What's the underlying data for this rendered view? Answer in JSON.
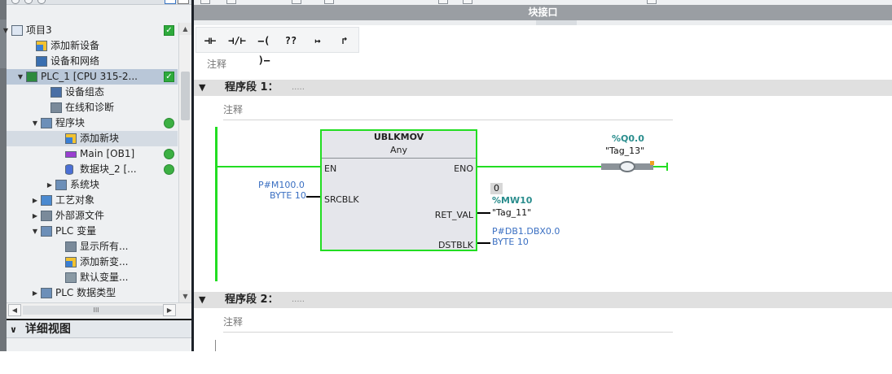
{
  "tree": {
    "rows": [
      {
        "label": "项目3",
        "icon": "project-icon",
        "arrow": "▼",
        "status": "check"
      },
      {
        "label": "添加新设备",
        "icon": "add-device-icon",
        "arrow": "",
        "status": ""
      },
      {
        "label": "设备和网络",
        "icon": "network-icon",
        "arrow": "",
        "status": ""
      },
      {
        "label": "PLC_1 [CPU 315-2...",
        "icon": "plc-icon",
        "arrow": "▼",
        "status": "check"
      },
      {
        "label": "设备组态",
        "icon": "device-config-icon",
        "arrow": "",
        "status": ""
      },
      {
        "label": "在线和诊断",
        "icon": "online-diag-icon",
        "arrow": "",
        "status": ""
      },
      {
        "label": "程序块",
        "icon": "folder-icon",
        "arrow": "▼",
        "status": "dot"
      },
      {
        "label": "添加新块",
        "icon": "add-block-icon",
        "arrow": "",
        "status": ""
      },
      {
        "label": "Main [OB1]",
        "icon": "ob-icon",
        "arrow": "",
        "status": "dot"
      },
      {
        "label": "数据块_2 [...",
        "icon": "db-icon",
        "arrow": "",
        "status": "dot"
      },
      {
        "label": "系统块",
        "icon": "folder-icon",
        "arrow": "▶",
        "status": ""
      },
      {
        "label": "工艺对象",
        "icon": "tech-object-icon",
        "arrow": "▶",
        "status": ""
      },
      {
        "label": "外部源文件",
        "icon": "source-file-icon",
        "arrow": "▶",
        "status": ""
      },
      {
        "label": "PLC 变量",
        "icon": "tag-folder-icon",
        "arrow": "▼",
        "status": ""
      },
      {
        "label": "显示所有...",
        "icon": "show-all-icon",
        "arrow": "",
        "status": ""
      },
      {
        "label": "添加新变...",
        "icon": "add-tag-icon",
        "arrow": "",
        "status": ""
      },
      {
        "label": "默认变量...",
        "icon": "tag-table-icon",
        "arrow": "",
        "status": ""
      },
      {
        "label": "PLC 数据类型",
        "icon": "data-type-icon",
        "arrow": "▶",
        "status": ""
      }
    ],
    "hscroll_label": "III"
  },
  "detail_view": {
    "title": "详细视图",
    "chevron": "∨"
  },
  "editor": {
    "block_interface": "块接口",
    "lad_toolbar": [
      "⊣⊢",
      "⊣/⊢",
      "–( )–",
      "??",
      "↦",
      "↱"
    ],
    "block_comment": "注释",
    "networks": [
      {
        "title": "程序段 1：",
        "dots": ".....",
        "comment": "注释"
      },
      {
        "title": "程序段 2：",
        "dots": ".....",
        "comment": "注释"
      }
    ],
    "block": {
      "name": "UBLKMOV",
      "type": "Any",
      "pins": {
        "en": "EN",
        "eno": "ENO",
        "srcblk": "SRCBLK",
        "ret_val": "RET_VAL",
        "dstblk": "DSTBLK"
      }
    },
    "operands": {
      "src_line1": "P#M100.0",
      "src_line2": "BYTE 10",
      "ret_value": "0",
      "ret_addr": "%MW10",
      "ret_tag": "\"Tag_11\"",
      "dst_line1": "P#DB1.DBX0.0",
      "dst_line2": "BYTE 10",
      "coil_addr": "%Q0.0",
      "coil_tag": "\"Tag_13\""
    }
  }
}
